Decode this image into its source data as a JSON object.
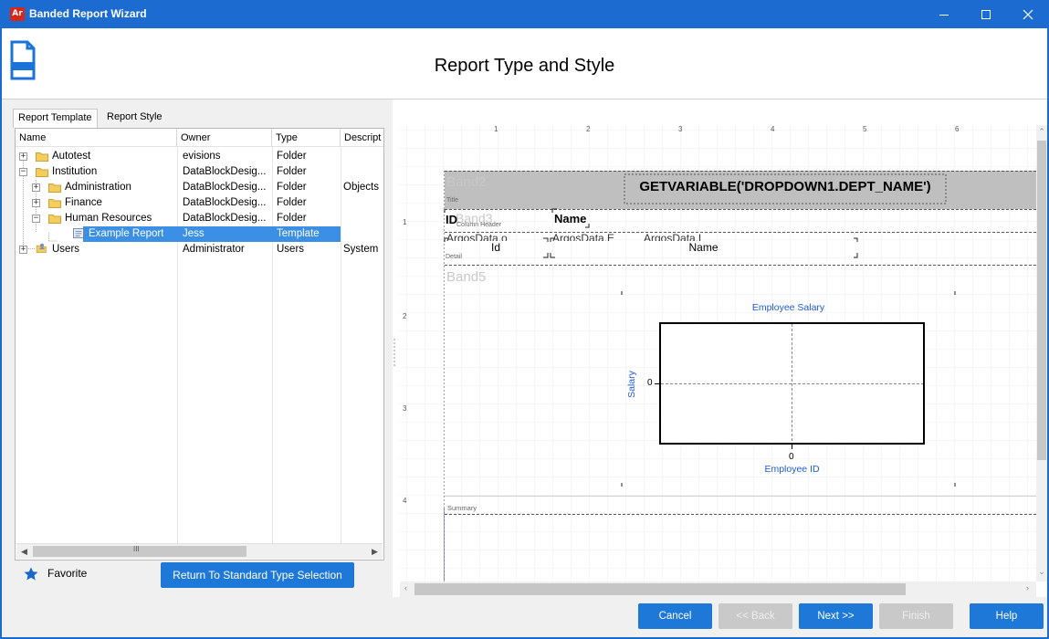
{
  "window": {
    "app_icon_text": "Ar",
    "title": "Banded Report Wizard"
  },
  "header": {
    "page_title": "Report Type and Style"
  },
  "tabs": [
    {
      "label": "Report Template",
      "active": true
    },
    {
      "label": "Report Style",
      "active": false
    }
  ],
  "grid": {
    "columns": [
      "Name",
      "Owner",
      "Type",
      "Descript"
    ],
    "rows": [
      {
        "name": "Autotest",
        "owner": "evisions",
        "type": "Folder",
        "description": "",
        "level": 0,
        "expander": "+",
        "icon": "folder-icon"
      },
      {
        "name": "Institution",
        "owner": "DataBlockDesig...",
        "type": "Folder",
        "description": "",
        "level": 0,
        "expander": "−",
        "icon": "folder-icon"
      },
      {
        "name": "Administration",
        "owner": "DataBlockDesig...",
        "type": "Folder",
        "description": "Objects",
        "level": 1,
        "expander": "+",
        "icon": "folder-icon"
      },
      {
        "name": "Finance",
        "owner": "DataBlockDesig...",
        "type": "Folder",
        "description": "",
        "level": 1,
        "expander": "+",
        "icon": "folder-icon"
      },
      {
        "name": "Human Resources",
        "owner": "DataBlockDesig...",
        "type": "Folder",
        "description": "",
        "level": 1,
        "expander": "−",
        "icon": "folder-icon"
      },
      {
        "name": "Example Report",
        "owner": "Jess",
        "type": "Template",
        "description": "",
        "level": 2,
        "expander": "",
        "icon": "report-icon",
        "selected": true
      },
      {
        "name": "Users",
        "owner": "Administrator",
        "type": "Users",
        "description": "System",
        "level": 0,
        "expander": "+",
        "icon": "users-icon"
      }
    ],
    "scroll_grip": "III"
  },
  "favorite": {
    "label": "Favorite"
  },
  "return_button": {
    "label": "Return To Standard Type Selection"
  },
  "designer": {
    "ruler_top": [
      "1",
      "2",
      "3",
      "4",
      "5",
      "6"
    ],
    "ruler_left": [
      "1",
      "2",
      "3",
      "4"
    ],
    "bands": {
      "title_band": "Band2",
      "title_small": "Title",
      "title_expression": "GETVARIABLE('DROPDOWN1.DEPT_NAME')",
      "column_header_band": "Band3",
      "column_header_small": "Column Header",
      "header_id": "ID",
      "header_name": "Name",
      "detail_small": "Detail",
      "detail_overlap_1": "ArgosData.o",
      "detail_overlap_2": "ArgosData.E",
      "detail_overlap_3": "ArgosData.L",
      "detail_id": "Id",
      "detail_name": "Name",
      "chart_band": "Band5",
      "summary_small": "Summary"
    }
  },
  "chart_data": {
    "type": "line",
    "title": "Employee Salary",
    "xlabel": "Employee ID",
    "ylabel": "Salary",
    "x_ticks": [
      "0"
    ],
    "y_ticks": [
      "0"
    ],
    "series": []
  },
  "buttons": {
    "cancel": "Cancel",
    "back": "<< Back",
    "next": "Next >>",
    "finish": "Finish",
    "help": "Help"
  },
  "colors": {
    "accent": "#1c6bd1",
    "button": "#1e78d8",
    "selection": "#3b8fe5",
    "disabled": "#c9c9c9",
    "chart_text": "#1f5bd6"
  }
}
